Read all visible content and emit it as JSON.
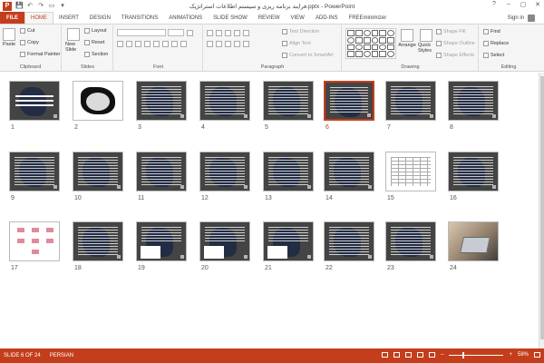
{
  "window": {
    "title": "فرایند برنامه ریزی و سیستم اطلاعات استراتژیک.pptx - PowerPoint",
    "app_letter": "P",
    "controls": [
      "?",
      "–",
      "▢",
      "✕"
    ]
  },
  "qat": {
    "save": "💾",
    "undo": "↶",
    "redo": "↷",
    "more": "▾"
  },
  "tabs": [
    {
      "label": "FILE"
    },
    {
      "label": "HOME"
    },
    {
      "label": "INSERT"
    },
    {
      "label": "DESIGN"
    },
    {
      "label": "TRANSITIONS"
    },
    {
      "label": "ANIMATIONS"
    },
    {
      "label": "SLIDE SHOW"
    },
    {
      "label": "REVIEW"
    },
    {
      "label": "VIEW"
    },
    {
      "label": "ADD-INS"
    },
    {
      "label": "FREEminimizer"
    }
  ],
  "signin": "Sign in",
  "ribbon": {
    "clipboard": {
      "label": "Clipboard",
      "paste": "Paste",
      "cut": "Cut",
      "copy": "Copy",
      "format_painter": "Format Painter"
    },
    "slides": {
      "label": "Slides",
      "new_slide": "New Slide",
      "layout": "Layout",
      "reset": "Reset",
      "section": "Section"
    },
    "font": {
      "label": "Font"
    },
    "paragraph": {
      "label": "Paragraph",
      "text_direction": "Text Direction",
      "align_text": "Align Text",
      "convert_smartart": "Convert to SmartArt"
    },
    "drawing": {
      "label": "Drawing",
      "arrange": "Arrange",
      "quick_styles": "Quick Styles",
      "shape_fill": "Shape Fill",
      "shape_outline": "Shape Outline",
      "shape_effects": "Shape Effects"
    },
    "editing": {
      "label": "Editing",
      "find": "Find",
      "replace": "Replace",
      "select": "Select"
    }
  },
  "slides": [
    {
      "num": "1",
      "kind": "title"
    },
    {
      "num": "2",
      "kind": "calli"
    },
    {
      "num": "3",
      "kind": "text"
    },
    {
      "num": "4",
      "kind": "text"
    },
    {
      "num": "5",
      "kind": "text"
    },
    {
      "num": "6",
      "kind": "text",
      "selected": true
    },
    {
      "num": "7",
      "kind": "text"
    },
    {
      "num": "8",
      "kind": "text"
    },
    {
      "num": "9",
      "kind": "text"
    },
    {
      "num": "10",
      "kind": "text"
    },
    {
      "num": "11",
      "kind": "text"
    },
    {
      "num": "12",
      "kind": "text"
    },
    {
      "num": "13",
      "kind": "text"
    },
    {
      "num": "14",
      "kind": "text"
    },
    {
      "num": "15",
      "kind": "table"
    },
    {
      "num": "16",
      "kind": "text"
    },
    {
      "num": "17",
      "kind": "flow"
    },
    {
      "num": "18",
      "kind": "text"
    },
    {
      "num": "19",
      "kind": "mixed"
    },
    {
      "num": "20",
      "kind": "mixed"
    },
    {
      "num": "21",
      "kind": "mixed"
    },
    {
      "num": "22",
      "kind": "text"
    },
    {
      "num": "23",
      "kind": "text"
    },
    {
      "num": "24",
      "kind": "photo"
    }
  ],
  "status": {
    "slide": "SLIDE 6 OF 24",
    "language": "PERSIAN",
    "zoom_minus": "–",
    "zoom_plus": "+",
    "zoom_value": 58,
    "zoom": "58%"
  },
  "colors": {
    "accent": "#c43e1c"
  }
}
